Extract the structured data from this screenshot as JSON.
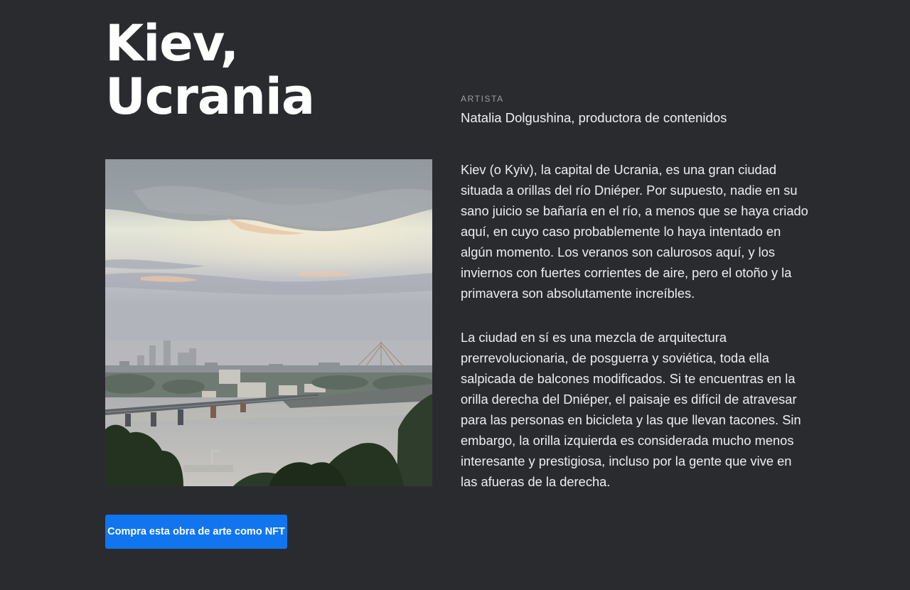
{
  "article": {
    "title_line1": "Kiev,",
    "title_line2": "Ucrania"
  },
  "artist": {
    "label": "ARTISTA",
    "name": "Natalia Dolgushina, productora de contenidos"
  },
  "artwork": {
    "subject": "Kiev skyline over the Dnieper river at sunset with bridges, city buildings and trees in the foreground"
  },
  "description": {
    "paragraph1": "Kiev (o Kyiv), la capital de Ucrania, es una gran ciudad situada a orillas del río Dniéper. Por supuesto, nadie en su sano juicio se bañaría en el río, a menos que se haya criado aquí, en cuyo caso probablemente lo haya intentado en algún momento. Los veranos son calurosos aquí, y los inviernos con fuertes corrientes de aire, pero el otoño y la primavera son absolutamente increíbles.",
    "paragraph2": "La ciudad en sí es una mezcla de arquitectura prerrevolucionaria, de posguerra y soviética, toda ella salpicada de balcones modificados. Si te encuentras en la orilla derecha del Dniéper, el paisaje es difícil de atravesar para las personas en bicicleta y las que llevan tacones. Sin embargo, la orilla izquierda es considerada mucho menos interesante y prestigiosa, incluso por la gente que vive en las afueras de la derecha."
  },
  "actions": {
    "buy_nft_label": "Compra esta obra de arte como NFT"
  },
  "colors": {
    "background": "#2a2b2f",
    "button": "#1175f0",
    "muted_label": "#9d9ea3"
  }
}
